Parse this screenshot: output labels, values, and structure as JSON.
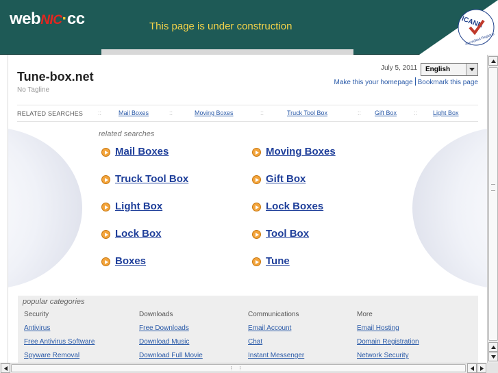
{
  "banner": {
    "logo_web": "web",
    "logo_nic": "NIC",
    "logo_dot": "·",
    "logo_cc": "cc",
    "message": "This page is under construction",
    "icann_text": "ICANN",
    "icann_sub": "Accredited Registrar"
  },
  "site": {
    "title": "Tune-box.net",
    "tagline": "No Tagline",
    "date": "July 5, 2011",
    "language": "English",
    "links": {
      "homepage": "Make this your homepage",
      "bookmark": "Bookmark this page"
    }
  },
  "related_bar": {
    "label": "RELATED SEARCHES",
    "separator": "::",
    "items": [
      "Mail Boxes",
      "Moving Boxes",
      "Truck Tool Box",
      "Gift Box",
      "Light Box"
    ]
  },
  "related_searches": {
    "heading": "related searches",
    "links": [
      "Mail Boxes",
      "Moving Boxes",
      "Truck Tool Box",
      "Gift Box",
      "Light Box",
      "Lock Boxes",
      "Lock Box",
      "Tool Box",
      "Boxes",
      "Tune"
    ]
  },
  "popular": {
    "heading": "popular categories",
    "columns": [
      {
        "title": "Security",
        "links": [
          "Antivirus",
          "Free Antivirus Software",
          "Spyware Removal"
        ]
      },
      {
        "title": "Downloads",
        "links": [
          "Free Downloads",
          "Download Music",
          "Download Full Movie"
        ]
      },
      {
        "title": "Communications",
        "links": [
          "Email Account",
          "Chat",
          "Instant Messenger"
        ]
      },
      {
        "title": "More",
        "links": [
          "Email Hosting",
          "Domain Registration",
          "Network Security"
        ]
      }
    ]
  },
  "colors": {
    "banner_bg": "#1e5a56",
    "banner_message": "#f4d34a",
    "link": "#1f3f9a",
    "bullet": "#f3a43b"
  }
}
